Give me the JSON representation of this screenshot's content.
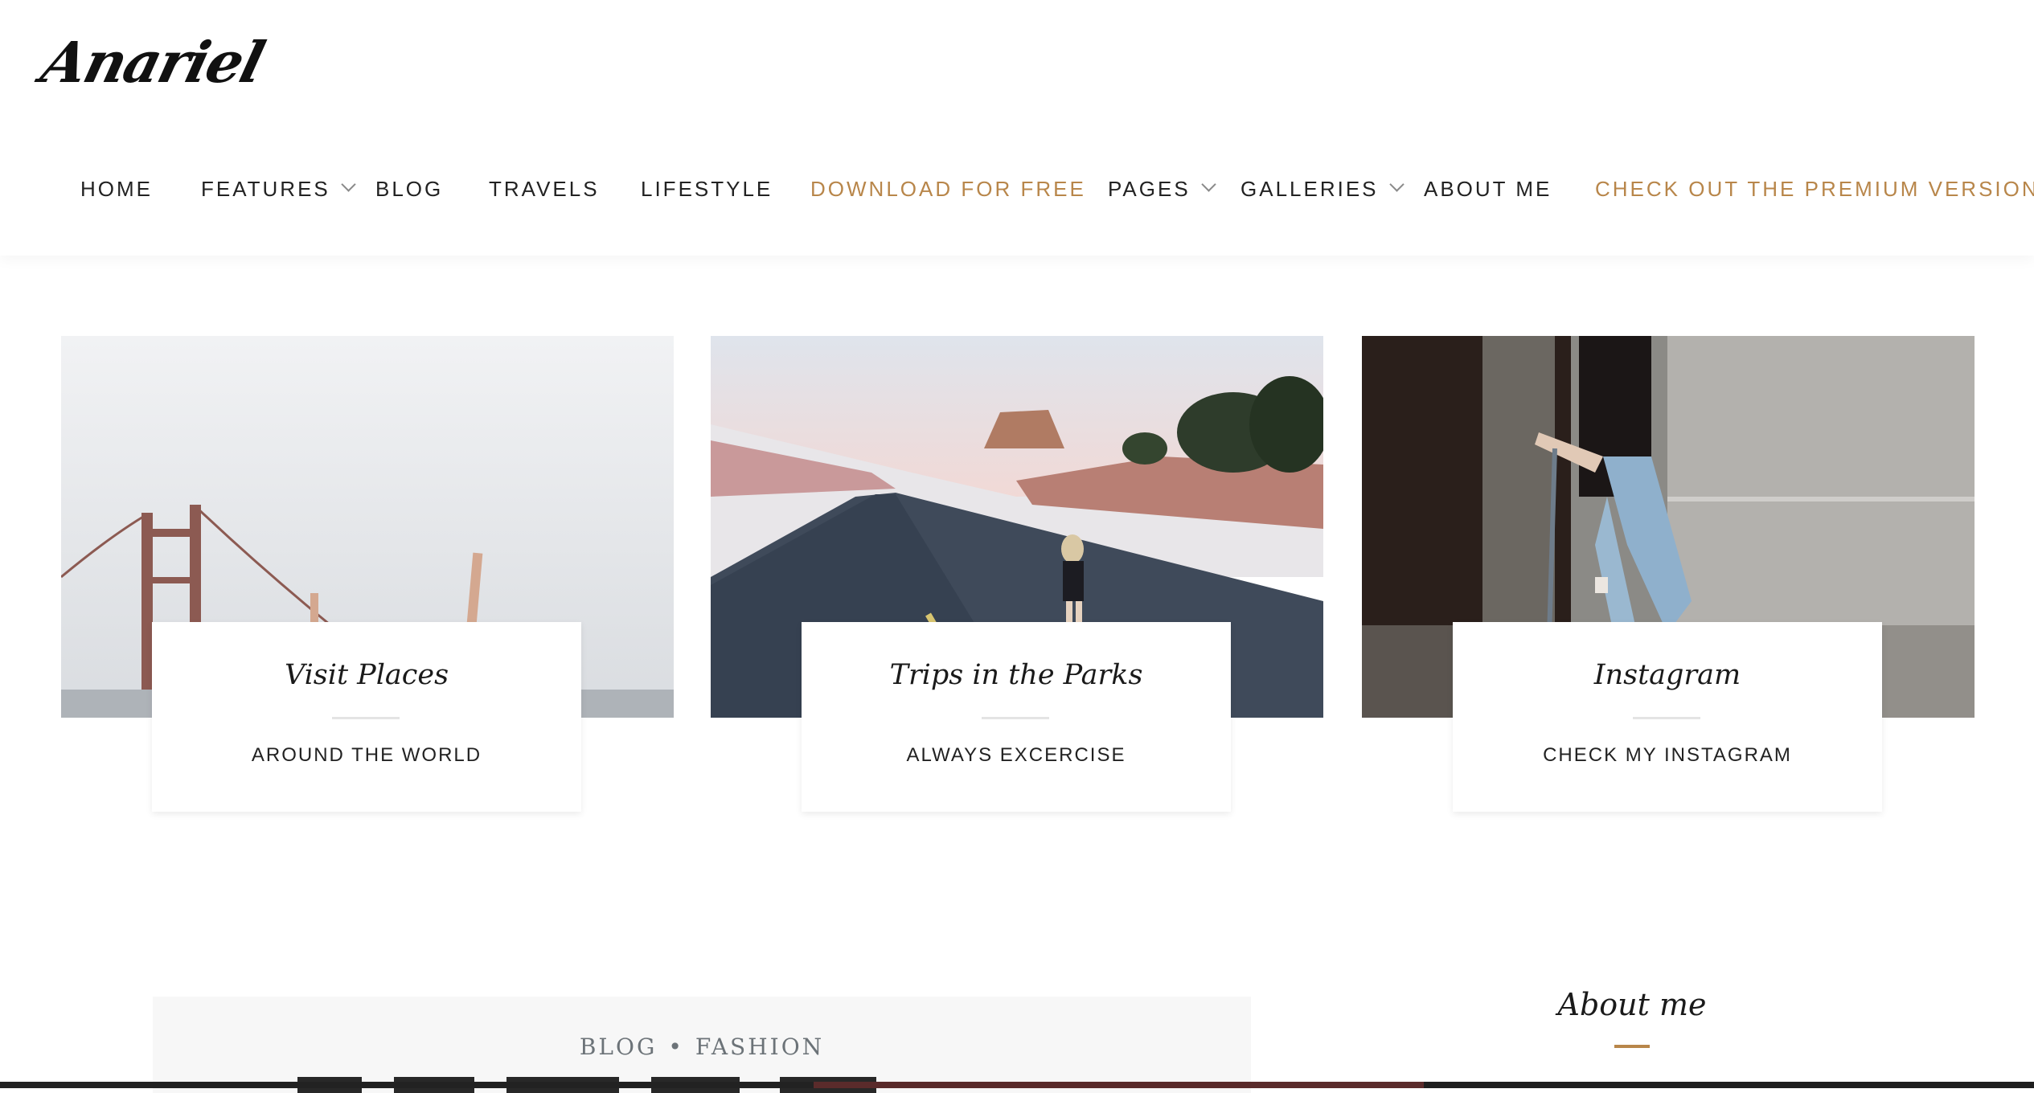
{
  "site": {
    "logo_text": "Anariel"
  },
  "nav": {
    "items": [
      {
        "label": "HOME",
        "has_dropdown": false,
        "accent": false
      },
      {
        "label": "FEATURES",
        "has_dropdown": true,
        "accent": false
      },
      {
        "label": "BLOG",
        "has_dropdown": false,
        "accent": false
      },
      {
        "label": "TRAVELS",
        "has_dropdown": false,
        "accent": false
      },
      {
        "label": "LIFESTYLE",
        "has_dropdown": false,
        "accent": false
      },
      {
        "label": "DOWNLOAD FOR FREE",
        "has_dropdown": false,
        "accent": true
      },
      {
        "label": "PAGES",
        "has_dropdown": true,
        "accent": false
      },
      {
        "label": "GALLERIES",
        "has_dropdown": true,
        "accent": false
      },
      {
        "label": "ABOUT ME",
        "has_dropdown": false,
        "accent": false
      },
      {
        "label": "CHECK OUT THE PREMIUM VERSION",
        "has_dropdown": false,
        "accent": true
      }
    ]
  },
  "cards": [
    {
      "title": "Visit Places",
      "subtitle": "AROUND THE WORLD"
    },
    {
      "title": "Trips in the Parks",
      "subtitle": "ALWAYS EXCERCISE"
    },
    {
      "title": "Instagram",
      "subtitle": "CHECK MY INSTAGRAM"
    }
  ],
  "post": {
    "category_1": "BLOG",
    "separator": "•",
    "category_2": "FASHION"
  },
  "sidebar": {
    "about_title": "About me"
  },
  "colors": {
    "accent": "#b8864a",
    "text": "#222222",
    "muted": "#6c7378",
    "post_bg": "#f7f7f7"
  }
}
